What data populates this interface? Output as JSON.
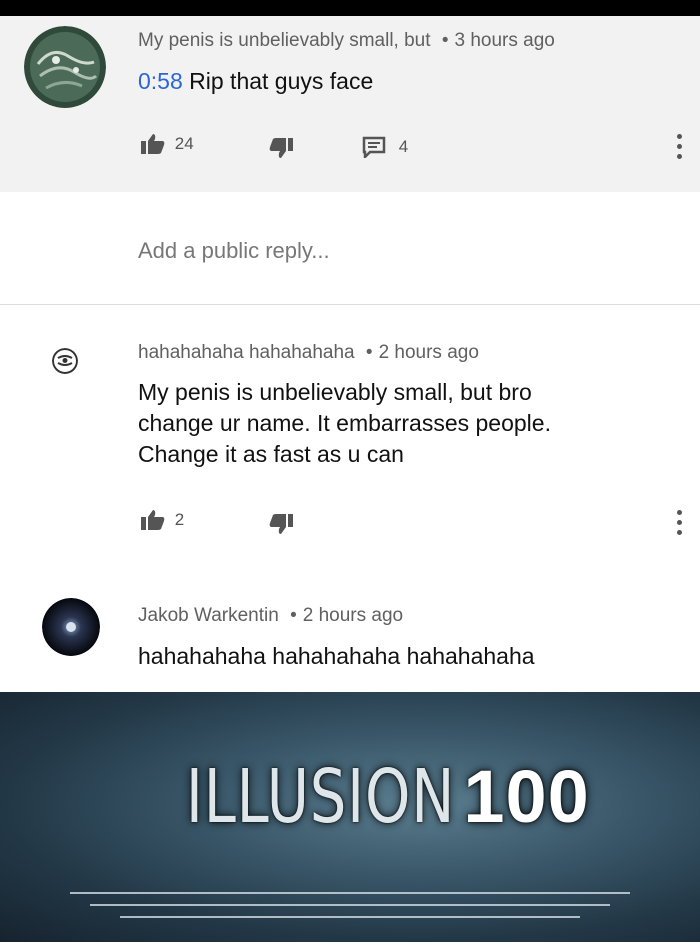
{
  "comments": [
    {
      "author": "My penis is unbelievably small, but",
      "time": "3 hours ago",
      "timestamp_link": "0:58",
      "text": "Rip that guys face",
      "likes": "24",
      "replies": "4"
    },
    {
      "author": "hahahahaha hahahahaha",
      "time": "2 hours ago",
      "text_lines": [
        "My penis is unbelievably small, but bro",
        "change ur name. It embarrasses people.",
        "Change it as fast as u can"
      ],
      "likes": "2"
    },
    {
      "author": "Jakob Warkentin",
      "time": "2 hours ago",
      "text": "hahahahaha hahahahaha hahahahaha"
    }
  ],
  "reply_placeholder": "Add a public reply...",
  "banner": {
    "word": "ILLUSION",
    "number": "100"
  },
  "separator": "•",
  "colors": {
    "timestamp_link": "#2b67d4",
    "highlight_bg": "#f2f2f2",
    "meta": "#606060"
  },
  "icons": [
    "thumbs-up-icon",
    "thumbs-down-icon",
    "reply-icon",
    "more-vert-icon"
  ]
}
